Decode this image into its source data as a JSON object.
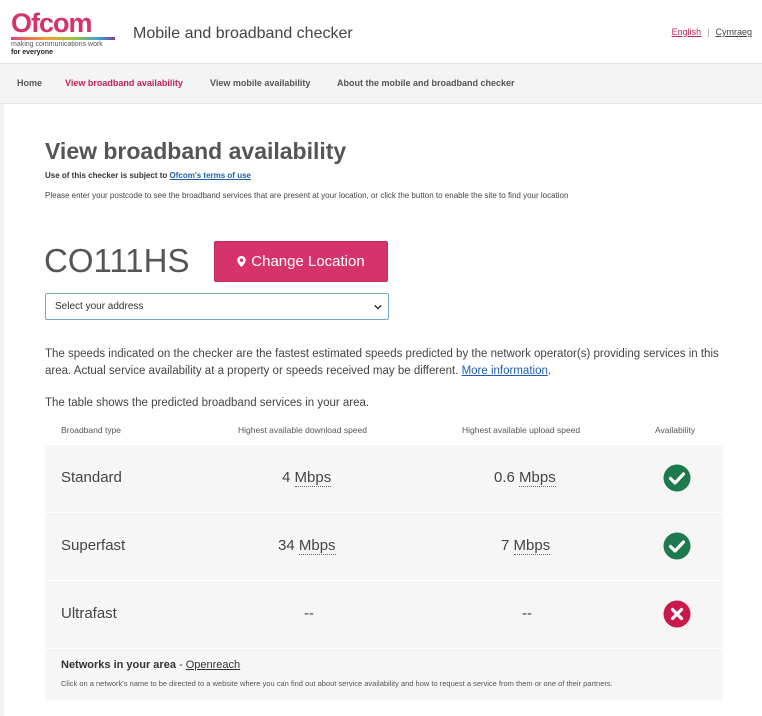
{
  "header": {
    "logo_word": "Ofcom",
    "logo_tagline_1": "making communications work",
    "logo_tagline_2": "for everyone",
    "app_title": "Mobile and broadband checker",
    "lang_english": "English",
    "lang_separator": "|",
    "lang_welsh": "Cymraeg"
  },
  "nav": {
    "items": [
      {
        "label": "Home"
      },
      {
        "label": "View broadband availability"
      },
      {
        "label": "View mobile availability"
      },
      {
        "label": "About the mobile and broadband checker"
      }
    ]
  },
  "main": {
    "title": "View broadband availability",
    "terms_prefix": "Use of this checker is subject to",
    "terms_link": "Ofcom's terms of use",
    "instructions": "Please enter your postcode to see the broadband services that are present at your location, or click the button to enable the site to find your location",
    "postcode": "CO111HS",
    "change_location_label": "Change Location",
    "address_select": "Select your address",
    "disclaimer_text": "The speeds indicated on the checker are the fastest estimated speeds predicted by the network operator(s) providing services in this area. Actual service availability at a property or speeds received may be different.",
    "disclaimer_link": "More information",
    "table_intro": "The table shows the predicted broadband services in your area."
  },
  "table": {
    "headers": {
      "type": "Broadband type",
      "download": "Highest available download speed",
      "upload": "Highest available upload speed",
      "availability": "Availability"
    },
    "rows": [
      {
        "type": "Standard",
        "download_value": "4",
        "download_unit": "Mbps",
        "upload_value": "0.6",
        "upload_unit": "Mbps",
        "available": "yes"
      },
      {
        "type": "Superfast",
        "download_value": "34",
        "download_unit": "Mbps",
        "upload_value": "7",
        "upload_unit": "Mbps",
        "available": "yes"
      },
      {
        "type": "Ultrafast",
        "download_value": "--",
        "download_unit": "",
        "upload_value": "--",
        "upload_unit": "",
        "available": "no"
      }
    ],
    "networks_label": "Networks in your area",
    "networks_dash": "-",
    "networks_link": "Openreach",
    "networks_note": "Click on a network's name to be directed to a website where you can find out about service availability and how to request a service from them or one of their partners."
  },
  "colors": {
    "brand": "#d6336c",
    "available": "#1e7a4c",
    "unavailable": "#c9184a",
    "link": "#1f5fa8"
  },
  "icons": {
    "available": "check-circle-icon",
    "unavailable": "cross-circle-icon",
    "location": "map-pin-icon",
    "select": "chevron-down-icon"
  }
}
